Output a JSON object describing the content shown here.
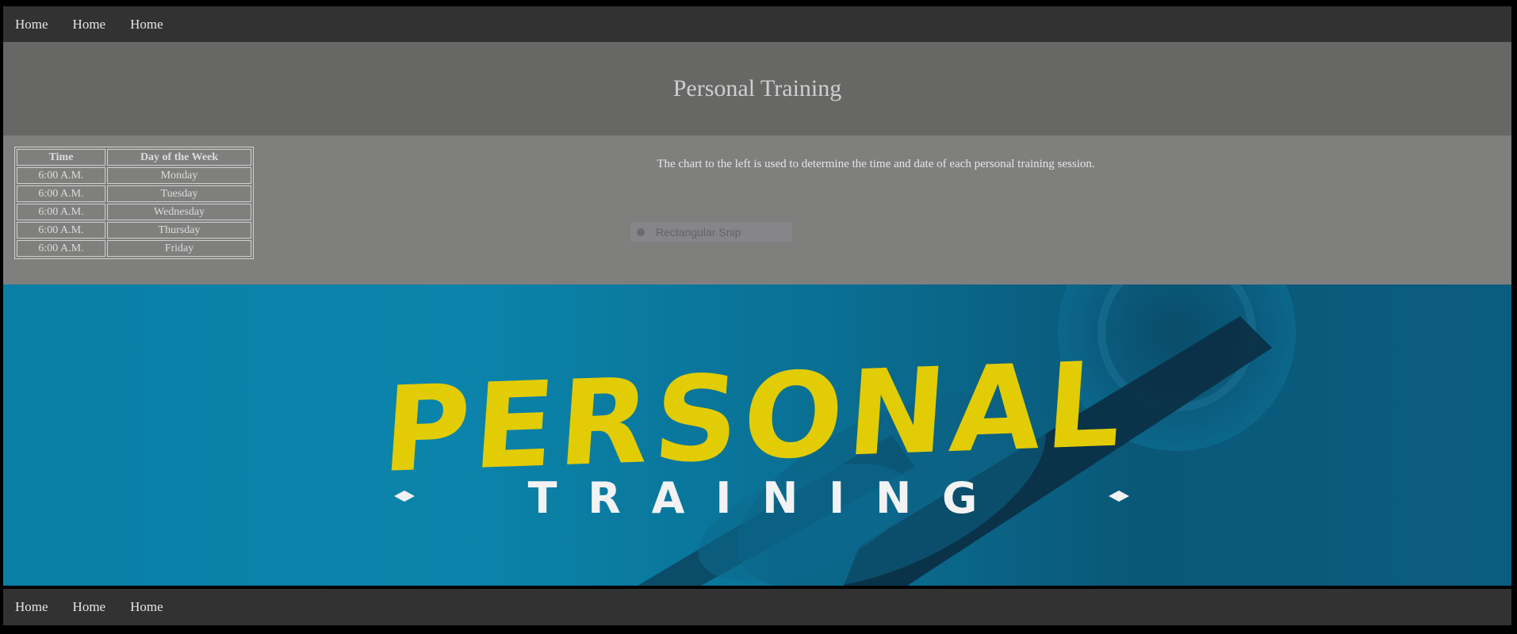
{
  "nav": {
    "top": [
      "Home",
      "Home",
      "Home"
    ],
    "bottom": [
      "Home",
      "Home",
      "Home"
    ]
  },
  "header": {
    "title": "Personal Training"
  },
  "schedule": {
    "headers": [
      "Time",
      "Day of the Week"
    ],
    "rows": [
      [
        "6:00 A.M.",
        "Monday"
      ],
      [
        "6:00 A.M.",
        "Tuesday"
      ],
      [
        "6:00 A.M.",
        "Wednesday"
      ],
      [
        "6:00 A.M.",
        "Thursday"
      ],
      [
        "6:00 A.M.",
        "Friday"
      ]
    ]
  },
  "description": "The chart to the left is used to determine the time and date of each personal training session.",
  "snip_overlay": {
    "label": "Rectangular Snip"
  },
  "banner": {
    "word1": "PERSONAL",
    "word2": "T R A I N I N G",
    "colors": {
      "background": "#0a7fa6",
      "word1": "#e2cc05",
      "word2": "#f2f2f2"
    }
  },
  "colors": {
    "nav_bg": "#333232",
    "header_bg": "#676766",
    "content_bg": "#7f7f7e"
  }
}
